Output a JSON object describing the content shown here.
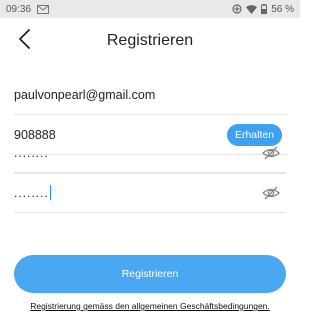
{
  "status_bar": {
    "time": "09:36",
    "battery": "56 %"
  },
  "header": {
    "title": "Registrieren",
    "back_icon": "chevron-left-icon"
  },
  "form": {
    "email": "paulvonpearl@gmail.com",
    "code": "908888",
    "get_code_label": "Erhalten",
    "password_masked": "........",
    "confirm_password_masked": "........",
    "visibility_icon": "eye-off-icon"
  },
  "register_label": "Registrieren",
  "terms_text": "Registrierung gemäss den allgemeinen Geschäftsbedingungen.",
  "colors": {
    "accent": "#3ea1f0",
    "status_bar_bg": "#e9e9e9"
  }
}
